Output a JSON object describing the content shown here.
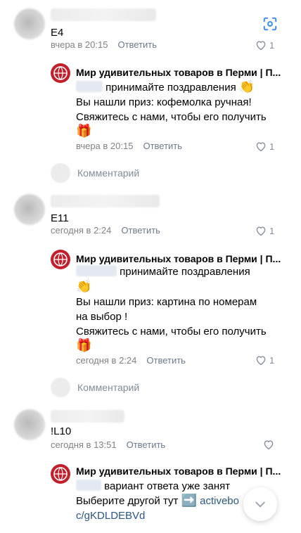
{
  "comments": [
    {
      "text": "E4",
      "time": "вчера в 20:15",
      "reply_label": "Ответить",
      "likes": "1"
    },
    {
      "text": "E11",
      "time": "сегодня в 2:24",
      "reply_label": "Ответить",
      "likes": "1"
    },
    {
      "text": "!L10",
      "time": "сегодня в 13:51",
      "reply_label": "Ответить",
      "likes": ""
    }
  ],
  "replies": [
    {
      "group_name": "Мир удивительных товаров в Перми | П...",
      "line1": "принимайте поздравления",
      "line2": "Вы нашли приз: кофемолка ручная!",
      "line3": "Свяжитесь с нами, чтобы его получить",
      "time": "вчера в 20:15",
      "reply_label": "Ответить",
      "likes": "1"
    },
    {
      "group_name": "Мир удивительных товаров в Перми | П...",
      "line1": "принимайте поздравления",
      "line2": "Вы нашли приз: картина по номерам",
      "line2b": "на выбор !",
      "line3": "Свяжитесь с нами, чтобы его получить",
      "time": "сегодня в 2:24",
      "reply_label": "Ответить",
      "likes": "1"
    },
    {
      "group_name": "Мир удивительных товаров в Перми | П...",
      "line1": "вариант ответа уже занят",
      "line2": "Выберите другой тут",
      "link_a": "activebo",
      "link_b": "c/gKDLDEBVd"
    }
  ],
  "comment_placeholder": "Комментарий",
  "icons": {
    "clap": "clapping-hands-icon",
    "gift": "gift-icon",
    "arrow": "right-arrow-icon",
    "heart": "heart-icon",
    "scan": "scan-icon",
    "chevron": "chevron-down-icon"
  },
  "colors": {
    "link": "#2a5885",
    "meta": "#828282",
    "brand": "#c31f2b"
  }
}
